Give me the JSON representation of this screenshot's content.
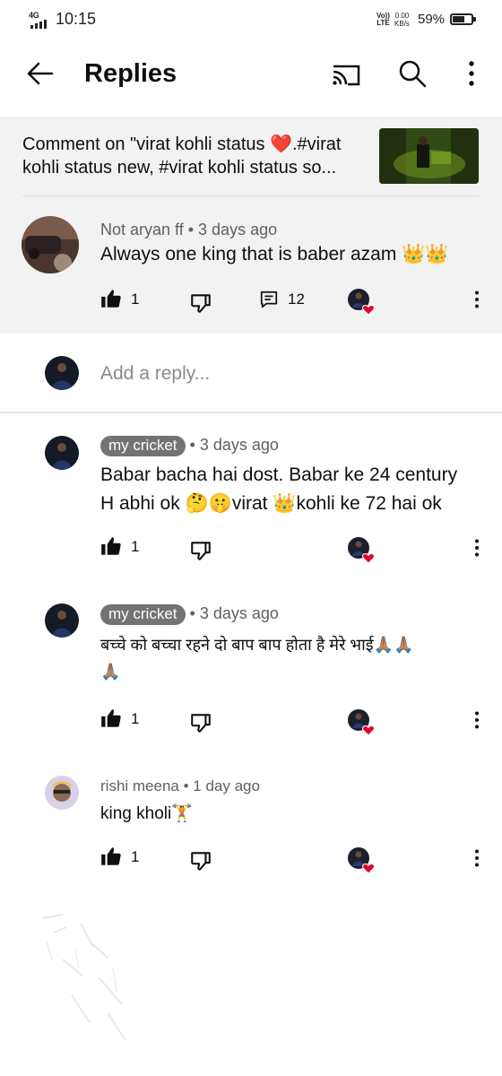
{
  "status_bar": {
    "network": "4G",
    "time": "10:15",
    "lte_top": "Vo))",
    "lte_bottom": "LTE",
    "speed_value": "0.00",
    "speed_unit": "KB/s",
    "battery_text": "59%",
    "battery_level": 0.59
  },
  "app_bar": {
    "title": "Replies",
    "back_icon": "arrow-left-icon",
    "cast_icon": "cast-icon",
    "search_icon": "search-icon",
    "more_icon": "more-vert-icon"
  },
  "context": {
    "line1": "Comment on \"virat kohli status ❤️.#virat",
    "line2": "kohli status new, #virat kohli status so..."
  },
  "parent_comment": {
    "author": "Not aryan ff",
    "age": "• 3 days ago",
    "text": "Always one king that is baber azam 👑👑",
    "likes": "1",
    "replies": "12"
  },
  "add_reply": {
    "placeholder": "Add a reply..."
  },
  "replies": [
    {
      "author": "my cricket",
      "age": "• 3 days ago",
      "line1": "Babar bacha  hai dost. Babar ke 24 century",
      "line2": "H abhi ok 🤔🤫virat 👑kohli ke 72 hai ok",
      "likes": "1"
    },
    {
      "author": "my cricket",
      "age": "• 3 days ago",
      "line1": "बच्चे को बच्चा रहने दो  बाप बाप होता है मेरे भाई🙏🏽🙏🏽",
      "line2": "🙏🏽",
      "likes": "1"
    },
    {
      "author": "rishi meena",
      "age": "• 1 day ago",
      "line1": "king kholi🏋️",
      "likes": "1"
    }
  ],
  "colors": {
    "parent_bg": "#f2f2f2",
    "pill_bg": "#737373",
    "heart": "#e4002b"
  }
}
